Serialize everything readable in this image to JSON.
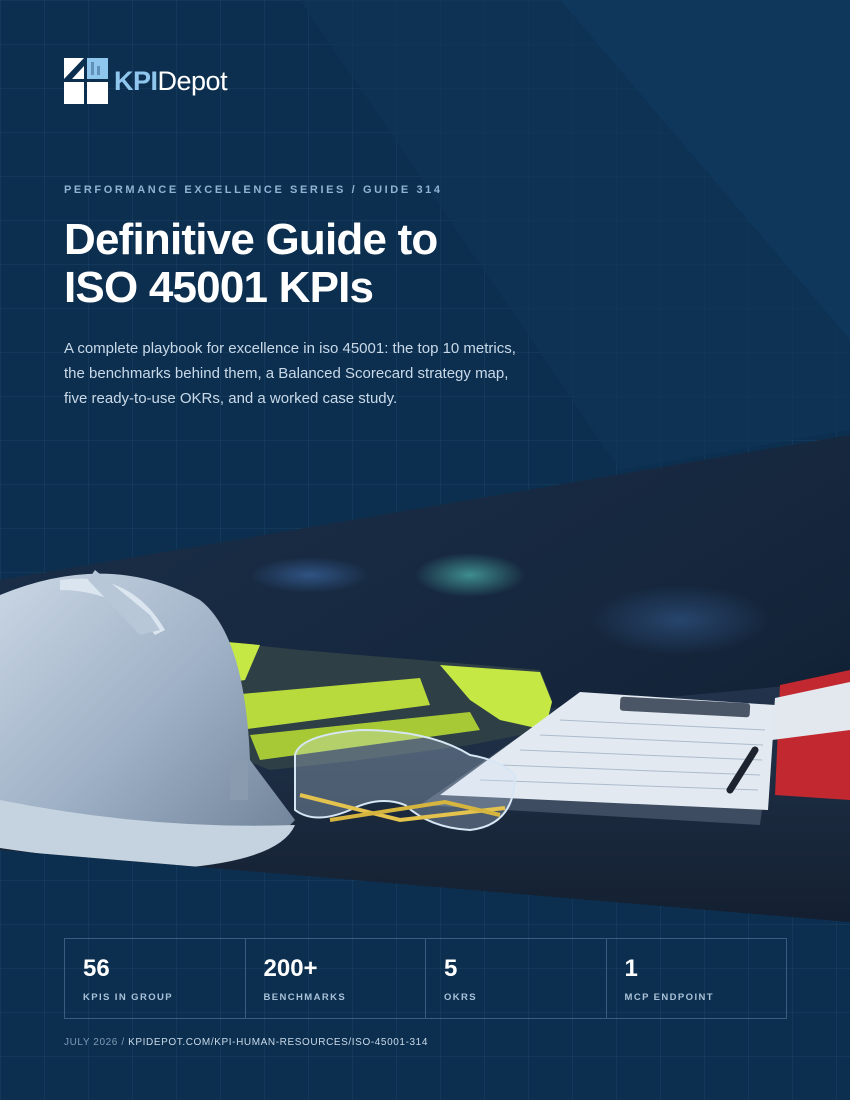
{
  "brand": {
    "kpi": "KPI",
    "depot": "Depot"
  },
  "series": "PERFORMANCE EXCELLENCE SERIES / GUIDE 314",
  "title": {
    "line1": "Definitive Guide to",
    "line2": "ISO 45001 KPIs"
  },
  "lede": "A complete playbook for excellence in iso 45001: the top 10 metrics, the benchmarks behind them, a Balanced Scorecard strategy map, five ready-to-use OKRs, and a worked case study.",
  "stats": [
    {
      "value": "56",
      "label": "KPIS IN GROUP"
    },
    {
      "value": "200+",
      "label": "BENCHMARKS"
    },
    {
      "value": "5",
      "label": "OKRS"
    },
    {
      "value": "1",
      "label": "MCP ENDPOINT"
    }
  ],
  "footer": {
    "date": "JULY 2026 / ",
    "url": "KPIDEPOT.COM/KPI-HUMAN-RESOURCES/ISO-45001-314"
  },
  "colors": {
    "background": "#0c2f50",
    "accent": "#8fc6ee",
    "text": "#ffffff"
  }
}
